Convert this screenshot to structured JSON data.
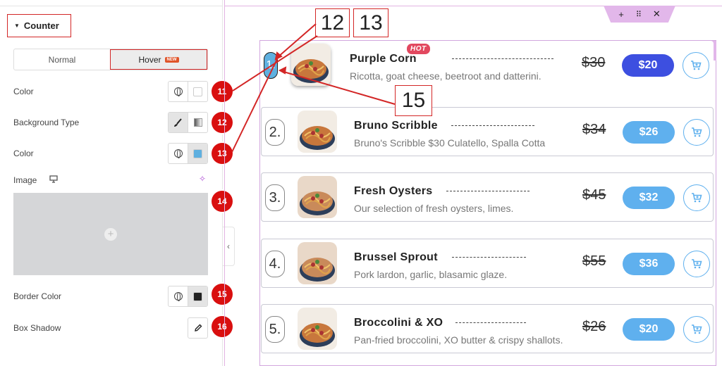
{
  "panel": {
    "section_title": "Counter",
    "tabs": [
      {
        "label": "Normal"
      },
      {
        "label": "Hover",
        "badge": "NEW"
      }
    ],
    "fields": {
      "color1": {
        "label": "Color",
        "swatch": "#ffffff"
      },
      "background_type": {
        "label": "Background Type"
      },
      "color2": {
        "label": "Color",
        "swatch": "#5fb0e0"
      },
      "image": {
        "label": "Image"
      },
      "border_color": {
        "label": "Border Color",
        "swatch": "#222222"
      },
      "box_shadow": {
        "label": "Box Shadow"
      }
    },
    "badges": [
      "11",
      "12",
      "13",
      "14",
      "15",
      "16"
    ]
  },
  "callouts": [
    "12",
    "13",
    "15"
  ],
  "menu": [
    {
      "number": "1.",
      "name": "Purple Corn",
      "hot": "HOT",
      "desc": "Ricotta, goat cheese, beetroot and datterini.",
      "old_price": "$30",
      "price": "$20",
      "highlight": true
    },
    {
      "number": "2.",
      "name": "Bruno Scribble",
      "desc": "Bruno's Scribble $30 Culatello, Spalla Cotta",
      "old_price": "$34",
      "price": "$26"
    },
    {
      "number": "3.",
      "name": "Fresh Oysters",
      "desc": "Our selection of fresh oysters, limes.",
      "old_price": "$45",
      "price": "$32"
    },
    {
      "number": "4.",
      "name": "Brussel Sprout",
      "desc": "Pork lardon, garlic, blasamic glaze.",
      "old_price": "$55",
      "price": "$36"
    },
    {
      "number": "5.",
      "name": "Broccolini & XO",
      "desc": "Pan-fried broccolini, XO butter & crispy shallots.",
      "old_price": "$26",
      "price": "$20"
    }
  ],
  "colors": {
    "accent_red": "#d32626",
    "badge_red": "#d90f0f",
    "price_blue": "#5fb0ee",
    "price_blue_active": "#3d4fe0",
    "counter_hover_bg": "#5fb0e0",
    "editor_purple": "#d2a6de"
  }
}
